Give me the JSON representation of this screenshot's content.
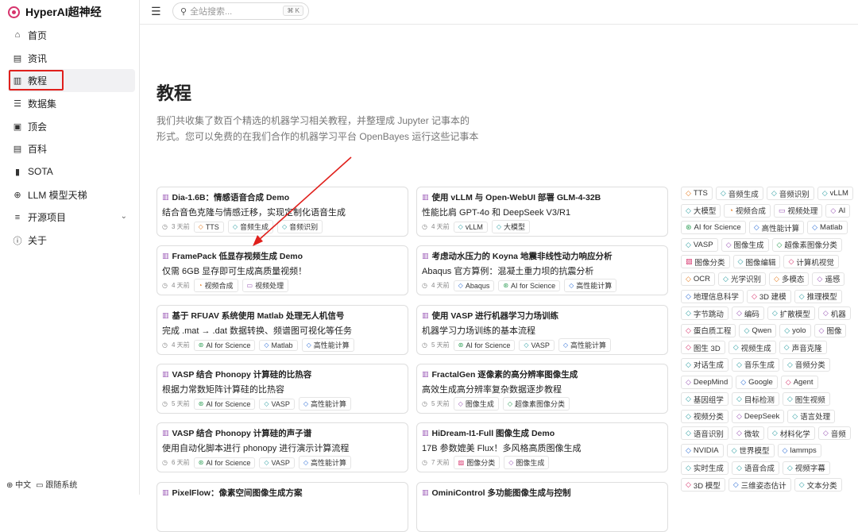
{
  "brand": {
    "name": "HyperAI超神经"
  },
  "nav": [
    {
      "label": "首页",
      "icon": "⌂"
    },
    {
      "label": "资讯",
      "icon": "▤"
    },
    {
      "label": "教程",
      "icon": "▥"
    },
    {
      "label": "数据集",
      "icon": "☰"
    },
    {
      "label": "顶会",
      "icon": "▣"
    },
    {
      "label": "百科",
      "icon": "▤"
    },
    {
      "label": "SOTA",
      "icon": "▮"
    },
    {
      "label": "LLM 模型天梯",
      "icon": "⊕"
    },
    {
      "label": "开源项目",
      "icon": "≡"
    },
    {
      "label": "关于",
      "icon": "ⓘ"
    }
  ],
  "footer": {
    "lang": "中文",
    "theme": "跟随系统"
  },
  "search": {
    "placeholder": "全站搜索...",
    "shortcut": "⌘ K"
  },
  "page": {
    "title": "教程",
    "desc1": "我们共收集了数百个精选的机器学习相关教程，并整理成 Jupyter 记事本的",
    "desc2": "形式。您可以免费的在我们合作的机器学习平台 OpenBayes 运行这些记事本"
  },
  "cards": [
    {
      "title": "Dia-1.6B：情感语音合成 Demo",
      "sub": "结合音色克隆与情感迁移，实现定制化语音生成",
      "time": "3 天前",
      "tags": [
        "TTS",
        "音频生成",
        "音频识别"
      ]
    },
    {
      "title": "使用 vLLM 与 Open-WebUI 部署 GLM-4-32B",
      "sub": "性能比肩 GPT-4o 和 DeepSeek V3/R1",
      "time": "4 天前",
      "tags": [
        "vLLM",
        "大模型"
      ]
    },
    {
      "title": "FramePack 低显存视频生成 Demo",
      "sub": "仅需 6GB 显存即可生成高质量视频！",
      "time": "4 天前",
      "tags": [
        "视频合成",
        "视频处理"
      ]
    },
    {
      "title": "考虑动水压力的 Koyna 地震非线性动力响应分析",
      "sub": "Abaqus 官方算例：混凝土重力坝的抗震分析",
      "time": "4 天前",
      "tags": [
        "Abaqus",
        "AI for Science",
        "高性能计算"
      ]
    },
    {
      "title": "基于 RFUAV 系统使用 Matlab 处理无人机信号",
      "sub": "完成 .mat → .dat 数据转换、频谱图可视化等任务",
      "time": "4 天前",
      "tags": [
        "AI for Science",
        "Matlab",
        "高性能计算"
      ]
    },
    {
      "title": "使用 VASP 进行机器学习力场训练",
      "sub": "机器学习力场训练的基本流程",
      "time": "5 天前",
      "tags": [
        "AI for Science",
        "VASP",
        "高性能计算"
      ]
    },
    {
      "title": "VASP 结合 Phonopy 计算硅的比热容",
      "sub": "根据力常数矩阵计算硅的比热容",
      "time": "5 天前",
      "tags": [
        "AI for Science",
        "VASP",
        "高性能计算"
      ]
    },
    {
      "title": "FractalGen 逐像素的高分辨率图像生成",
      "sub": "高效生成高分辨率复杂数据逐步教程",
      "time": "5 天前",
      "tags": [
        "图像生成",
        "超像素图像分类"
      ]
    },
    {
      "title": "VASP 结合 Phonopy 计算硅的声子谱",
      "sub": "使用自动化脚本进行 phonopy 进行演示计算流程",
      "time": "6 天前",
      "tags": [
        "AI for Science",
        "VASP",
        "高性能计算"
      ]
    },
    {
      "title": "HiDream-I1-Full 图像生成 Demo",
      "sub": "17B 参数媲美 Flux！多风格高质图像生成",
      "time": "7 天前",
      "tags": [
        "图像分类",
        "图像生成"
      ]
    },
    {
      "title": "PixelFlow：像素空间图像生成方案",
      "sub": "",
      "time": "",
      "tags": []
    },
    {
      "title": "OminiControl 多功能图像生成与控制",
      "sub": "",
      "time": "",
      "tags": []
    }
  ],
  "cloud": [
    [
      "TTS",
      "音频生成",
      "音频识别",
      "vLLM"
    ],
    [
      "大模型",
      "视频合成",
      "视频处理",
      "AI"
    ],
    [
      "AI for Science",
      "高性能计算",
      "Matlab"
    ],
    [
      "VASP",
      "图像生成",
      "超像素图像分类"
    ],
    [
      "图像分类",
      "图像编辑",
      "计算机视觉"
    ],
    [
      "OCR",
      "光学识别",
      "多模态",
      "遥感"
    ],
    [
      "地理信息科学",
      "3D 建模",
      "推理模型"
    ],
    [
      "字节跳动",
      "编码",
      "扩散模型",
      "机器"
    ],
    [
      "蛋白质工程",
      "Qwen",
      "yolo",
      "图像"
    ],
    [
      "图生 3D",
      "视频生成",
      "声音克隆"
    ],
    [
      "对话生成",
      "音乐生成",
      "音频分类"
    ],
    [
      "DeepMind",
      "Google",
      "Agent"
    ],
    [
      "基因组学",
      "目标检测",
      "图生视频"
    ],
    [
      "视频分类",
      "DeepSeek",
      "语言处理"
    ],
    [
      "语音识别",
      "微软",
      "材料化学",
      "音频"
    ],
    [
      "NVIDIA",
      "世界模型",
      "lammps"
    ],
    [
      "实时生成",
      "语音合成",
      "视频字幕"
    ],
    [
      "3D 模型",
      "三维姿态估计",
      "文本分类"
    ]
  ]
}
